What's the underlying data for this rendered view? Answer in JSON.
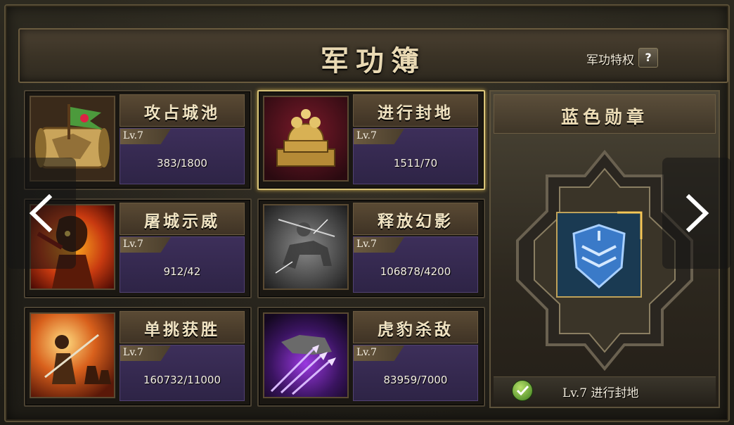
{
  "header": {
    "title": "军功簿",
    "privilege_label": "军功特权",
    "help_label": "?"
  },
  "cards": [
    {
      "name": "攻占城池",
      "level": "Lv.7",
      "progress": "383/1800",
      "icon": "war-flag-scroll-icon",
      "selected": false
    },
    {
      "name": "进行封地",
      "level": "Lv.7",
      "progress": "1511/70",
      "icon": "golden-seal-icon",
      "selected": true
    },
    {
      "name": "屠城示威",
      "level": "Lv.7",
      "progress": "912/42",
      "icon": "fire-warrior-icon",
      "selected": false
    },
    {
      "name": "释放幻影",
      "level": "Lv.7",
      "progress": "106878/4200",
      "icon": "phantom-cavalry-icon",
      "selected": false
    },
    {
      "name": "单挑获胜",
      "level": "Lv.7",
      "progress": "160732/11000",
      "icon": "duel-general-icon",
      "selected": false
    },
    {
      "name": "虎豹杀敌",
      "level": "Lv.7",
      "progress": "83959/7000",
      "icon": "purple-spear-cavalry-icon",
      "selected": false
    }
  ],
  "medal": {
    "title": "蓝色勋章",
    "status": "Lv.7 进行封地",
    "icon": "blue-shield-medal-icon",
    "check_icon": "green-check-icon"
  },
  "nav": {
    "prev_icon": "chevron-left-icon",
    "next_icon": "chevron-right-icon"
  },
  "colors": {
    "accent_gold": "#d8c47a",
    "stat_purple": "#3d2f5a",
    "medal_blue": "#3a7ac8"
  }
}
